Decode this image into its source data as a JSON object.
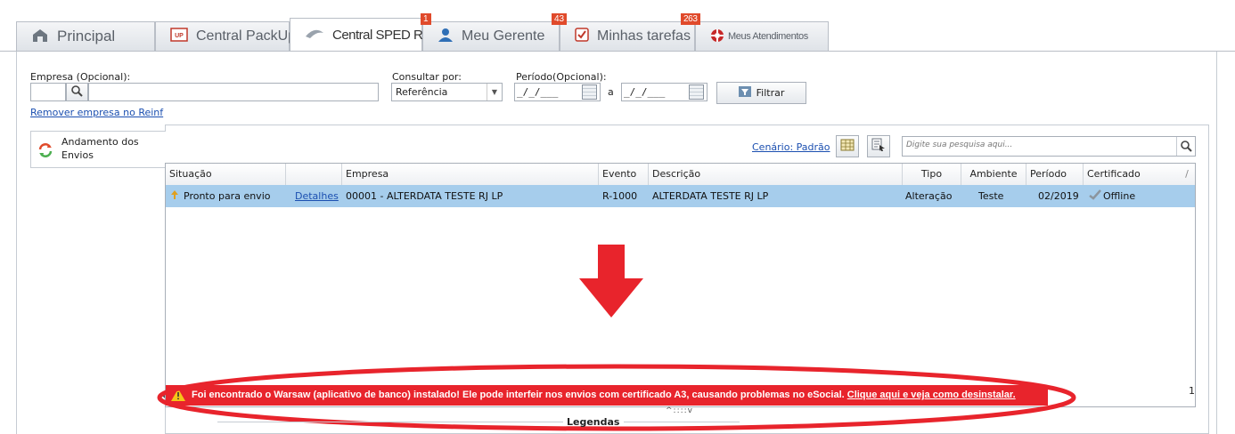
{
  "tabs": [
    {
      "label": "Principal",
      "icon": "home-icon"
    },
    {
      "label": "Central PackUp",
      "icon": "packup-icon"
    },
    {
      "label": "Central SPED Reinf",
      "icon": "reinf-icon"
    },
    {
      "label": "Meu Gerente",
      "icon": "user-icon",
      "badge": "1"
    },
    {
      "label": "Minhas tarefas",
      "icon": "checkbox-icon",
      "badge": "43"
    },
    {
      "label": "Meus Atendimentos",
      "icon": "lifebuoy-icon",
      "badge": "263"
    }
  ],
  "filters": {
    "empresa_label": "Empresa (Opcional):",
    "empresa_code": "",
    "empresa_name": "",
    "remover_link": "Remover empresa no Reinf",
    "consultar_label": "Consultar por:",
    "consultar_value": "Referência",
    "periodo_label": "Período(Opcional):",
    "periodo_inicio": "_/_/___",
    "periodo_sep": "a",
    "periodo_fim": "_/_/___",
    "filtrar_label": "Filtrar"
  },
  "side_tab": {
    "label_line1": "Andamento dos",
    "label_line2": "Envios"
  },
  "toolbar": {
    "cenario_link": "Cenário: Padrão",
    "search_placeholder": "Digite sua pesquisa aqui..."
  },
  "table": {
    "columns": [
      "Situação",
      "",
      "Empresa",
      "Evento",
      "Descrição",
      "Tipo",
      "Ambiente",
      "Período",
      "Certificado",
      "/"
    ],
    "rows": [
      {
        "situacao": "Pronto para envio",
        "detalhes": "Detalhes",
        "empresa": "00001 - ALTERDATA TESTE RJ LP",
        "evento": "R-1000",
        "descricao": "ALTERDATA TESTE RJ LP",
        "tipo": "Alteração",
        "ambiente": "Teste",
        "periodo": "02/2019",
        "certificado": "Offline"
      }
    ]
  },
  "alert": {
    "text": "Foi encontrado o Warsaw (aplicativo de banco) instalado! Ele pode interfeir nos envios com certificado A3, causando problemas no eSocial.",
    "link": "Clique aqui e veja como desinstalar.",
    "color": "#e8242c"
  },
  "footer": {
    "record_count": "1",
    "legendas_label": "Legendas"
  },
  "colors": {
    "selected_row": "#a6cdec",
    "annotation_red": "#e8242c",
    "link": "#1b4fb0"
  }
}
